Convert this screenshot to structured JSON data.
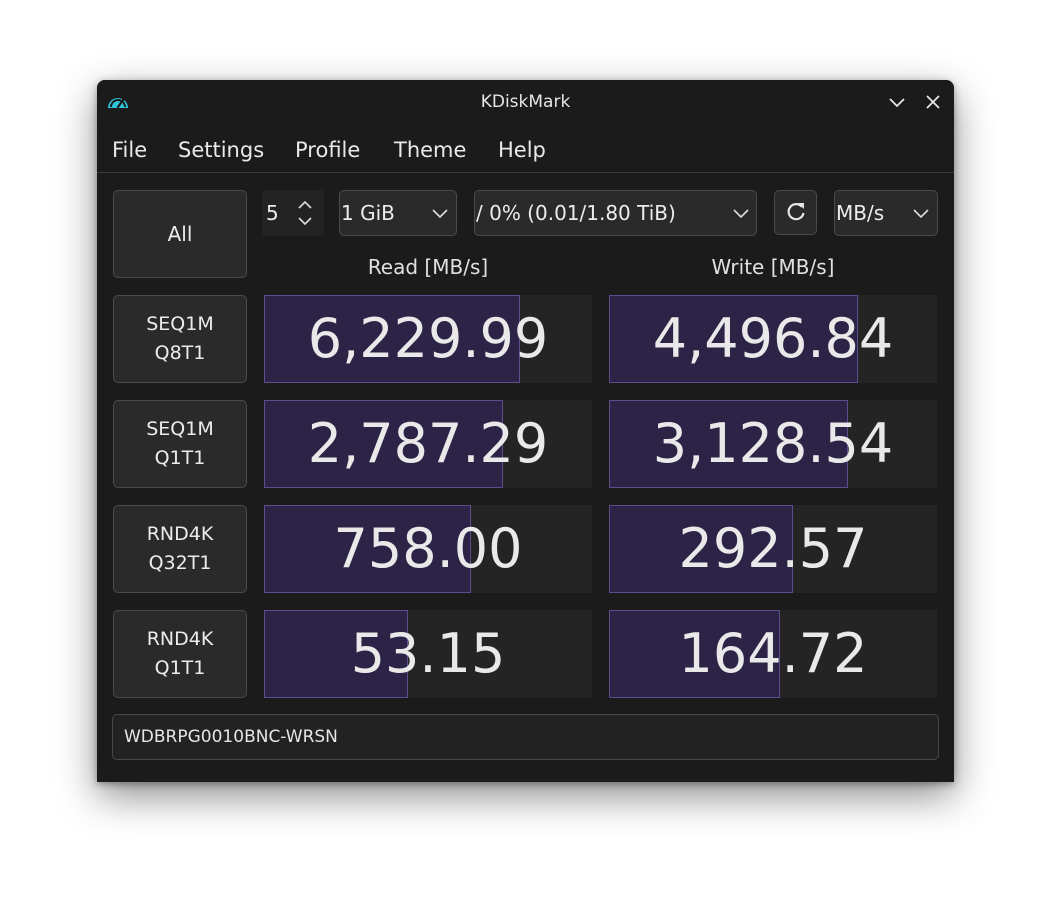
{
  "window": {
    "title": "KDiskMark",
    "app_icon": "gauge-icon",
    "controls": [
      "minimize-chevron-icon",
      "close-icon"
    ]
  },
  "menu": {
    "items": [
      {
        "label": "File"
      },
      {
        "label": "Settings"
      },
      {
        "label": "Profile"
      },
      {
        "label": "Theme"
      },
      {
        "label": "Help"
      }
    ]
  },
  "toolbar": {
    "all_label": "All",
    "count_value": "5",
    "size_value": "1 GiB",
    "target_value": "/ 0% (0.01/1.80 TiB)",
    "refresh_icon": "refresh-icon",
    "unit_value": "MB/s"
  },
  "headers": {
    "read": "Read [MB/s]",
    "write": "Write [MB/s]"
  },
  "tests": [
    {
      "line1": "SEQ1M",
      "line2": "Q8T1",
      "read": "6,229.99",
      "read_level": 0.78,
      "write": "4,496.84",
      "write_level": 0.76
    },
    {
      "line1": "SEQ1M",
      "line2": "Q1T1",
      "read": "2,787.29",
      "read_level": 0.73,
      "write": "3,128.54",
      "write_level": 0.73
    },
    {
      "line1": "RND4K",
      "line2": "Q32T1",
      "read": "758.00",
      "read_level": 0.63,
      "write": "292.57",
      "write_level": 0.56
    },
    {
      "line1": "RND4K",
      "line2": "Q1T1",
      "read": "53.15",
      "read_level": 0.44,
      "write": "164.72",
      "write_level": 0.52
    }
  ],
  "comment": "WDBRPG0010BNC-WRSN",
  "colors": {
    "bar_fill": "#2c2346",
    "bar_border": "#5c4e8d",
    "window_bg": "#1b1b1b"
  }
}
